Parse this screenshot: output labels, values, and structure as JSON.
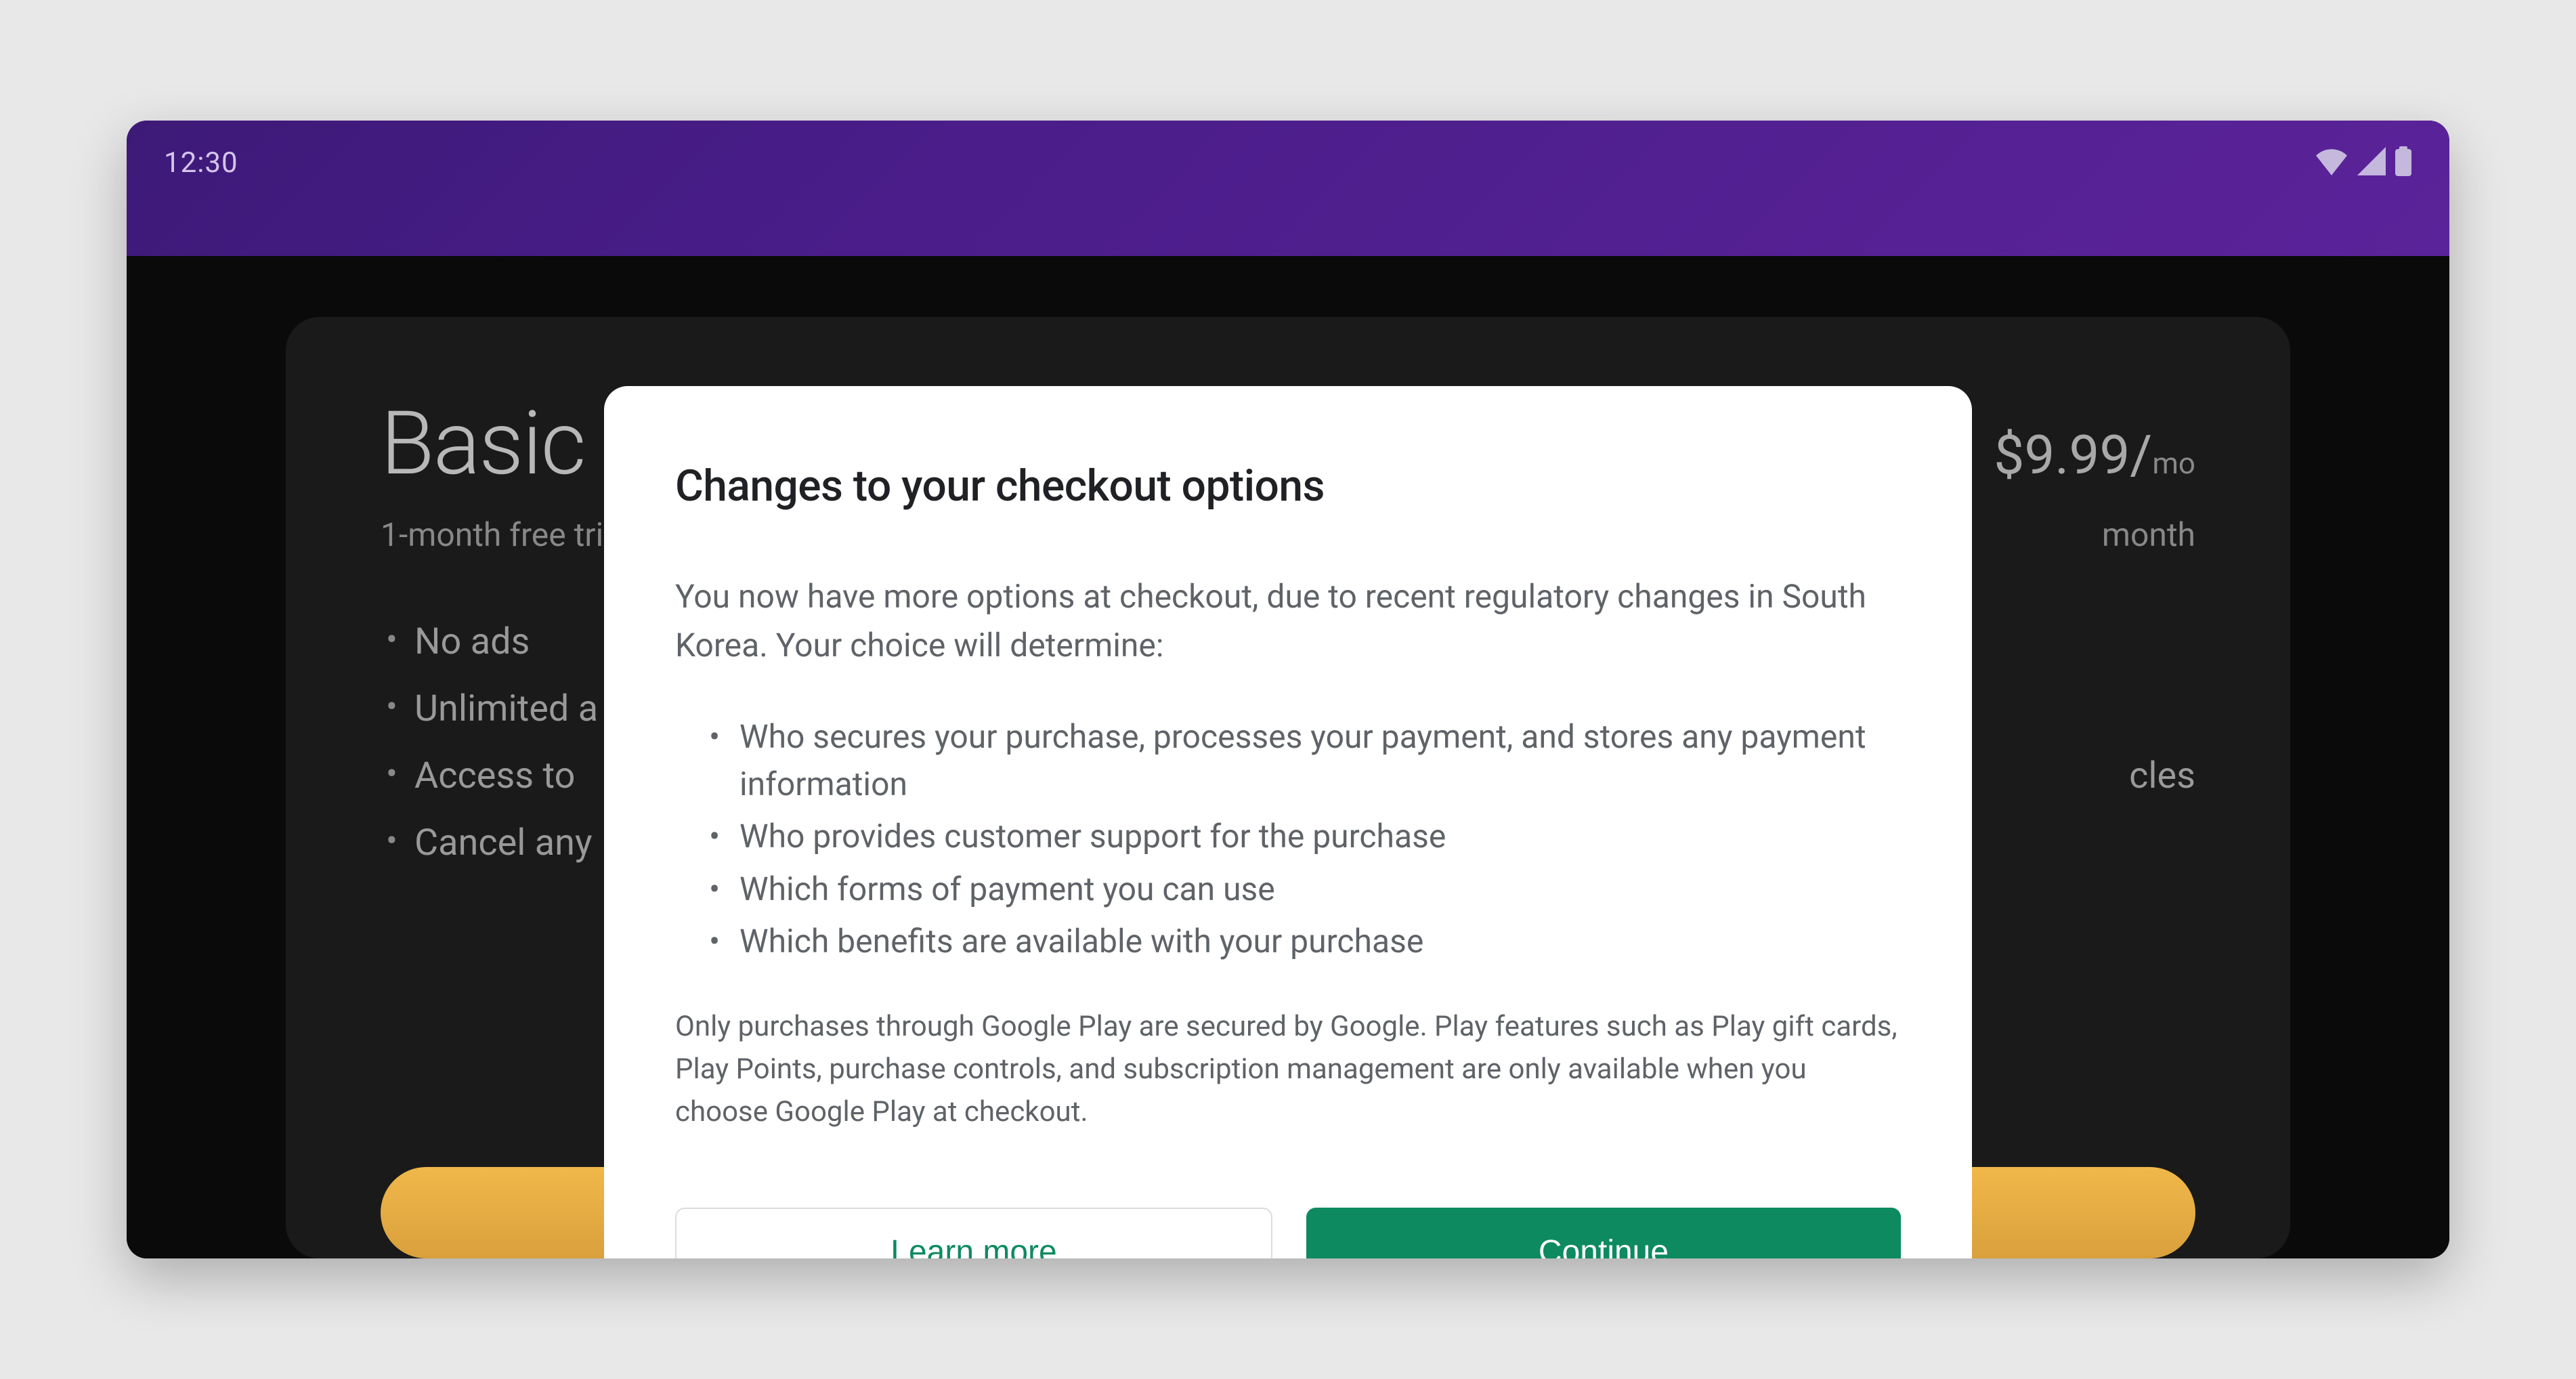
{
  "status_bar": {
    "time": "12:30"
  },
  "plan": {
    "title": "Basic",
    "price": "$9.99/",
    "price_unit": "mo",
    "subtitle_left": "1-month free trial",
    "subtitle_right": "month",
    "features": [
      "No ads",
      "Unlimited a",
      "Access to",
      "Cancel any"
    ],
    "feature_right_fragment": "cles",
    "subscribe_label": ""
  },
  "modal": {
    "title": "Changes to your checkout options",
    "intro": "You now have more options at checkout, due to recent regulatory changes in South Korea. Your choice will determine:",
    "bullets": [
      "Who secures your purchase, processes your payment, and stores any payment information",
      "Who provides customer support for the purchase",
      "Which forms of payment you can use",
      "Which benefits are available with your purchase"
    ],
    "footnote": "Only purchases through Google Play are secured by Google. Play features such as Play gift cards, Play Points, purchase controls, and subscription management are only available when you choose Google Play at checkout.",
    "learn_more_label": "Learn more",
    "continue_label": "Continue"
  }
}
